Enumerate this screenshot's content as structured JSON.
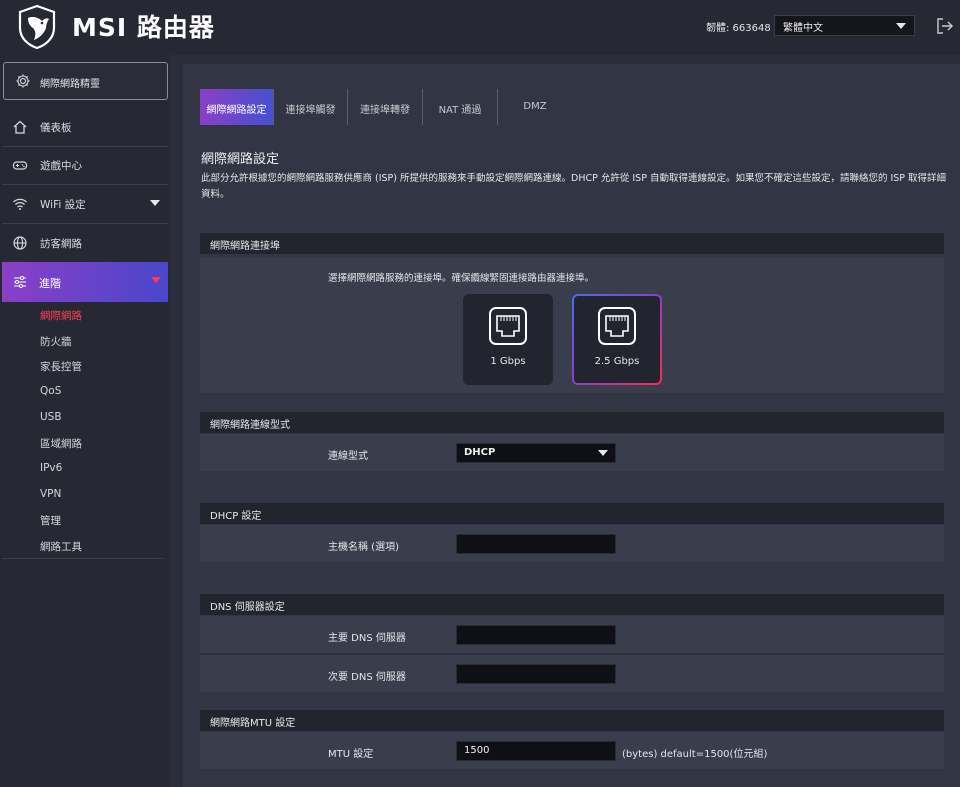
{
  "header": {
    "brand": "MSI 路由器",
    "firmware": "韌體: 663648",
    "language": "繁體中文"
  },
  "sidebar": {
    "wizard": "網際網路精靈",
    "items": [
      {
        "label": "儀表板",
        "icon": "home-icon"
      },
      {
        "label": "遊戲中心",
        "icon": "gamepad-icon"
      },
      {
        "label": "WiFi 設定",
        "icon": "wifi-icon"
      },
      {
        "label": "訪客網路",
        "icon": "globe-icon"
      },
      {
        "label": "進階",
        "icon": "sliders-icon"
      }
    ],
    "submenu": [
      "網際網路",
      "防火牆",
      "家長控管",
      "QoS",
      "USB",
      "區域網路",
      "IPv6",
      "VPN",
      "管理",
      "網路工具"
    ]
  },
  "tabs": [
    "網際網路設定",
    "連接埠觸發",
    "連接埠轉發",
    "NAT 通過",
    "DMZ"
  ],
  "page": {
    "title": "網際網路設定",
    "description": "此部分允許根據您的網際網路服務供應商 (ISP) 所提供的服務來手動設定網際網路連線。DHCP 允許從 ISP 自動取得連線設定。如果您不確定這些設定，請聯絡您的 ISP 取得詳細資料。"
  },
  "port_section": {
    "title": "網際網路連接埠",
    "instruction": "選擇網際網路服務的連接埠。確保纜線緊固連接路由器連接埠。",
    "ports": [
      {
        "label": "1 Gbps",
        "selected": false
      },
      {
        "label": "2.5 Gbps",
        "selected": true
      }
    ]
  },
  "conn_section": {
    "title": "網際網路連線型式",
    "label": "連線型式",
    "value": "DHCP"
  },
  "dhcp_section": {
    "title": "DHCP 設定",
    "hostname_label": "主機名稱 (選項)",
    "hostname_value": ""
  },
  "dns_section": {
    "title": "DNS 伺服器設定",
    "primary_label": "主要 DNS 伺服器",
    "primary_value": "",
    "secondary_label": "次要 DNS 伺服器",
    "secondary_value": ""
  },
  "mtu_section": {
    "title": "網際網路MTU 設定",
    "label": "MTU 設定",
    "value": "1500",
    "hint": "(bytes) default=1500(位元組)"
  },
  "colors": {
    "accent_purple": "#8a3fc6",
    "accent_blue": "#4650d0",
    "accent_red": "#ff3e55"
  }
}
